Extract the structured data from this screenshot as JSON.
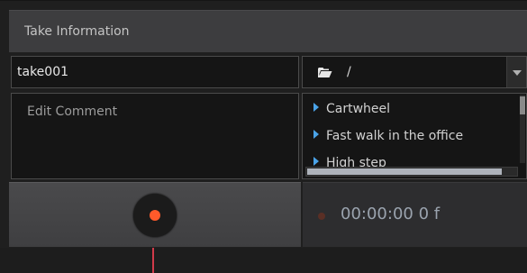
{
  "header": {
    "title": "Take Information"
  },
  "take": {
    "name": "take001"
  },
  "path": {
    "value": "/"
  },
  "comment": {
    "placeholder": "Edit Comment"
  },
  "motions": {
    "items": [
      {
        "label": "Cartwheel"
      },
      {
        "label": "Fast walk in the office"
      },
      {
        "label": "High step"
      }
    ]
  },
  "record": {
    "timecode": "00:00:00 0 f"
  },
  "colors": {
    "record_dot": "#ff5a2a",
    "list_arrow": "#4aa3e8",
    "playhead": "#d13a4a"
  }
}
